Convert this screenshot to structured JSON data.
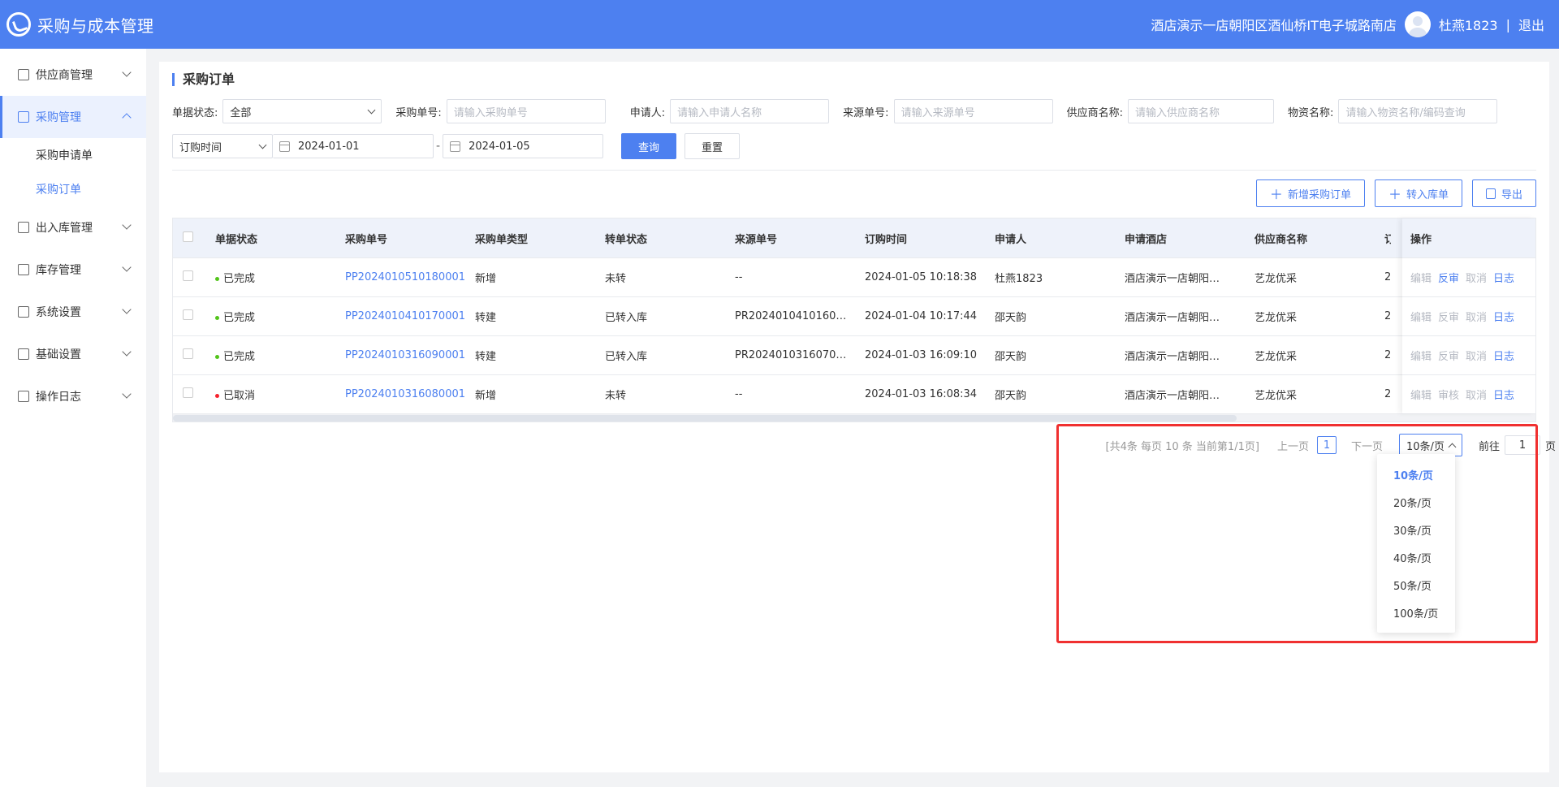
{
  "header": {
    "app_title": "采购与成本管理",
    "store_name": "酒店演示一店朝阳区酒仙桥IT电子城路南店",
    "user_name": "杜燕1823",
    "separator": "|",
    "logout": "退出"
  },
  "sidebar": {
    "items": [
      {
        "label": "供应商管理"
      },
      {
        "label": "采购管理"
      },
      {
        "label": "出入库管理"
      },
      {
        "label": "库存管理"
      },
      {
        "label": "系统设置"
      },
      {
        "label": "基础设置"
      },
      {
        "label": "操作日志"
      }
    ],
    "sub_items": [
      {
        "label": "采购申请单"
      },
      {
        "label": "采购订单"
      }
    ]
  },
  "page": {
    "title": "采购订单"
  },
  "filters": {
    "status_label": "单据状态:",
    "status_value": "全部",
    "order_no_label": "采购单号:",
    "order_no_placeholder": "请输入采购单号",
    "applicant_label": "申请人:",
    "applicant_placeholder": "请输入申请人名称",
    "source_label": "来源单号:",
    "source_placeholder": "请输入来源单号",
    "supplier_label": "供应商名称:",
    "supplier_placeholder": "请输入供应商名称",
    "material_label": "物资名称:",
    "material_placeholder": "请输入物资名称/编码查询",
    "date_type": "订购时间",
    "date_start": "2024-01-01",
    "date_sep": "-",
    "date_end": "2024-01-05",
    "query": "查询",
    "reset": "重置"
  },
  "actions": {
    "add": "新增采购订单",
    "transfer": "转入库单",
    "export": "导出"
  },
  "table": {
    "headers": [
      "单据状态",
      "采购单号",
      "采购单类型",
      "转单状态",
      "来源单号",
      "订购时间",
      "申请人",
      "申请酒店",
      "供应商名称",
      "订"
    ],
    "op_header": "操作",
    "rows": [
      {
        "status": "已完成",
        "status_color": "#52c41a",
        "order_no": "PP2024010510180001",
        "type": "新增",
        "transfer": "未转",
        "source": "--",
        "time": "2024-01-05 10:18:38",
        "applicant": "杜燕1823",
        "hotel": "酒店演示一店朝阳…",
        "supplier": "艺龙优采",
        "extra": "2",
        "ops": [
          "编辑",
          "反审",
          "取消",
          "日志"
        ]
      },
      {
        "status": "已完成",
        "status_color": "#52c41a",
        "order_no": "PP2024010410170001",
        "type": "转建",
        "transfer": "已转入库",
        "source": "PR2024010410160…",
        "time": "2024-01-04 10:17:44",
        "applicant": "邵天韵",
        "hotel": "酒店演示一店朝阳…",
        "supplier": "艺龙优采",
        "extra": "2",
        "ops": [
          "编辑",
          "反审",
          "取消",
          "日志"
        ]
      },
      {
        "status": "已完成",
        "status_color": "#52c41a",
        "order_no": "PP2024010316090001",
        "type": "转建",
        "transfer": "已转入库",
        "source": "PR2024010316070…",
        "time": "2024-01-03 16:09:10",
        "applicant": "邵天韵",
        "hotel": "酒店演示一店朝阳…",
        "supplier": "艺龙优采",
        "extra": "2",
        "ops": [
          "编辑",
          "反审",
          "取消",
          "日志"
        ]
      },
      {
        "status": "已取消",
        "status_color": "#f5222d",
        "order_no": "PP2024010316080001",
        "type": "新增",
        "transfer": "未转",
        "source": "--",
        "time": "2024-01-03 16:08:34",
        "applicant": "邵天韵",
        "hotel": "酒店演示一店朝阳…",
        "supplier": "艺龙优采",
        "extra": "2",
        "ops": [
          "编辑",
          "审核",
          "取消",
          "日志"
        ]
      }
    ]
  },
  "pagination": {
    "summary": "[共4条 每页 10 条 当前第1/1页]",
    "prev": "上一页",
    "current": "1",
    "next": "下一页",
    "size_value": "10条/页",
    "goto_label": "前往",
    "goto_value": "1",
    "page_unit": "页",
    "size_options": [
      "10条/页",
      "20条/页",
      "30条/页",
      "40条/页",
      "50条/页",
      "100条/页"
    ]
  },
  "colors": {
    "accent": "#4d80f0",
    "highlight": "#f03030"
  }
}
